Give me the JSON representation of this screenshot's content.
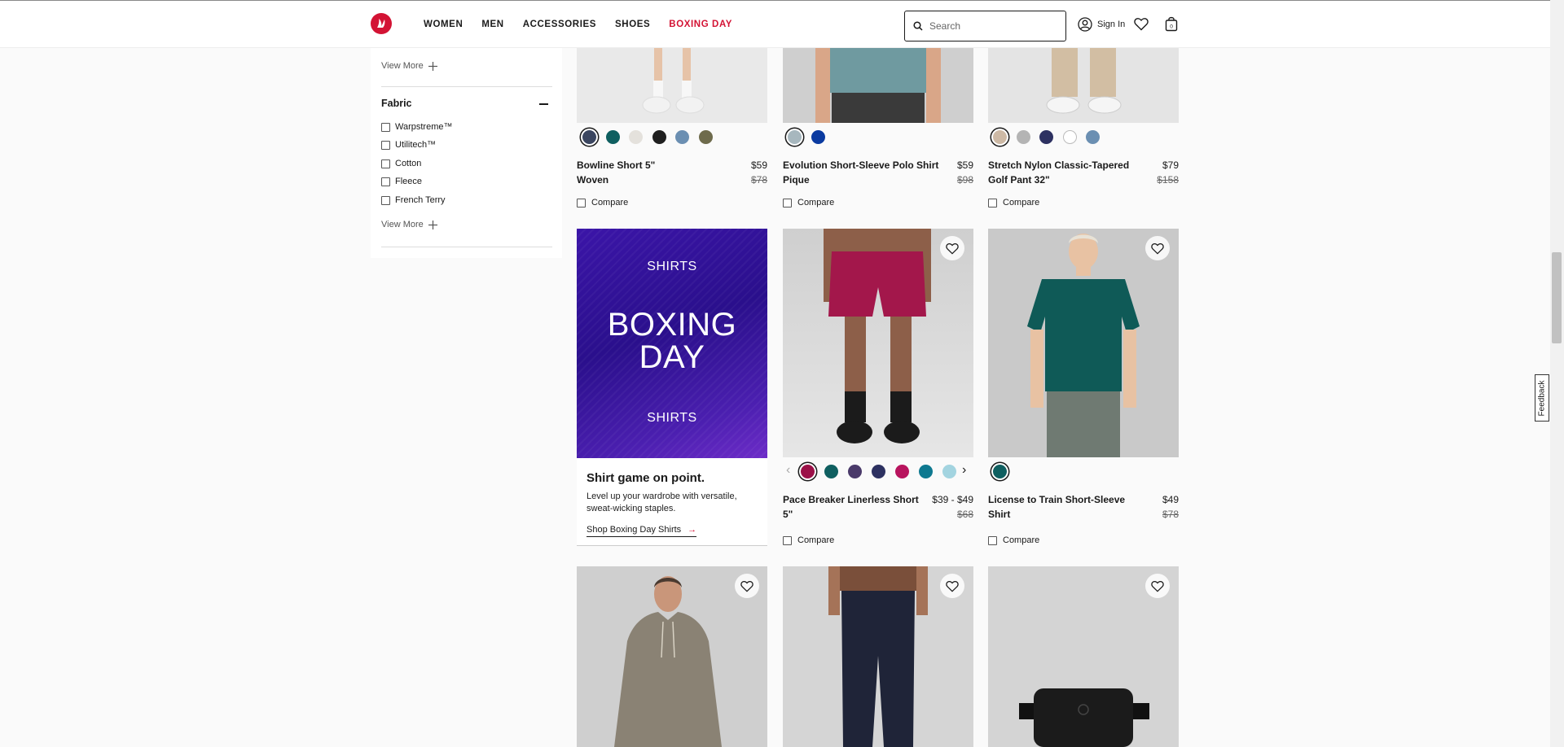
{
  "header": {
    "nav": [
      "WOMEN",
      "MEN",
      "ACCESSORIES",
      "SHOES",
      "BOXING DAY"
    ],
    "search_placeholder": "Search",
    "signin": "Sign In",
    "bag_count": "0"
  },
  "sidebar": {
    "view_more_1": "View More",
    "fabric_title": "Fabric",
    "fabrics": [
      "Warpstreme™",
      "Utilitech™",
      "Cotton",
      "Fleece",
      "French Terry"
    ],
    "view_more_2": "View More"
  },
  "products": {
    "p1": {
      "name_l1": "Bowline Short 5\"",
      "name_l2": "Woven",
      "price": "$59",
      "old_price": "$78",
      "compare": "Compare",
      "swatches": [
        "#3b4660",
        "#0f5f60",
        "#e4e1dc",
        "#1f1f1f",
        "#6b8fb2",
        "#6e6b4c"
      ]
    },
    "p2": {
      "name_l1": "Evolution Short-Sleeve Polo Shirt",
      "name_l2": "Pique",
      "price": "$59",
      "old_price": "$98",
      "compare": "Compare",
      "swatches": [
        "#a7b7be",
        "#0a3aa0"
      ]
    },
    "p3": {
      "name_l1": "Stretch Nylon Classic-Tapered",
      "name_l2": "Golf Pant 32\"",
      "price": "$79",
      "old_price": "$158",
      "compare": "Compare",
      "swatches": [
        "#cdb9a5",
        "#b4b4b4",
        "#2d3161",
        "#ffffff",
        "#6b8fb2"
      ]
    },
    "p4": {
      "name_l1": "Pace Breaker Linerless Short",
      "name_l2": "5\"",
      "price": "$39 - $49",
      "old_price": "$68",
      "compare": "Compare",
      "swatches": [
        "#9b1148",
        "#0f5f60",
        "#4a3a6a",
        "#2d3161",
        "#b8145e",
        "#0e7990",
        "#a3d4e0"
      ]
    },
    "p5": {
      "name_l1": "License to Train Short-Sleeve Shirt",
      "name_l2": "",
      "price": "$49",
      "old_price": "$78",
      "compare": "Compare",
      "swatches": [
        "#0f5f60"
      ]
    }
  },
  "promo": {
    "top": "SHIRTS",
    "big_l1": "BOXING",
    "big_l2": "DAY",
    "bottom": "SHIRTS",
    "headline": "Shirt game on point.",
    "desc": "Level up your wardrobe with versatile, sweat-wicking staples.",
    "link": "Shop Boxing Day Shirts"
  },
  "feedback": "Feedback",
  "colors": {
    "brand_red": "#d31334",
    "promo_purple": "#3b15a8"
  }
}
